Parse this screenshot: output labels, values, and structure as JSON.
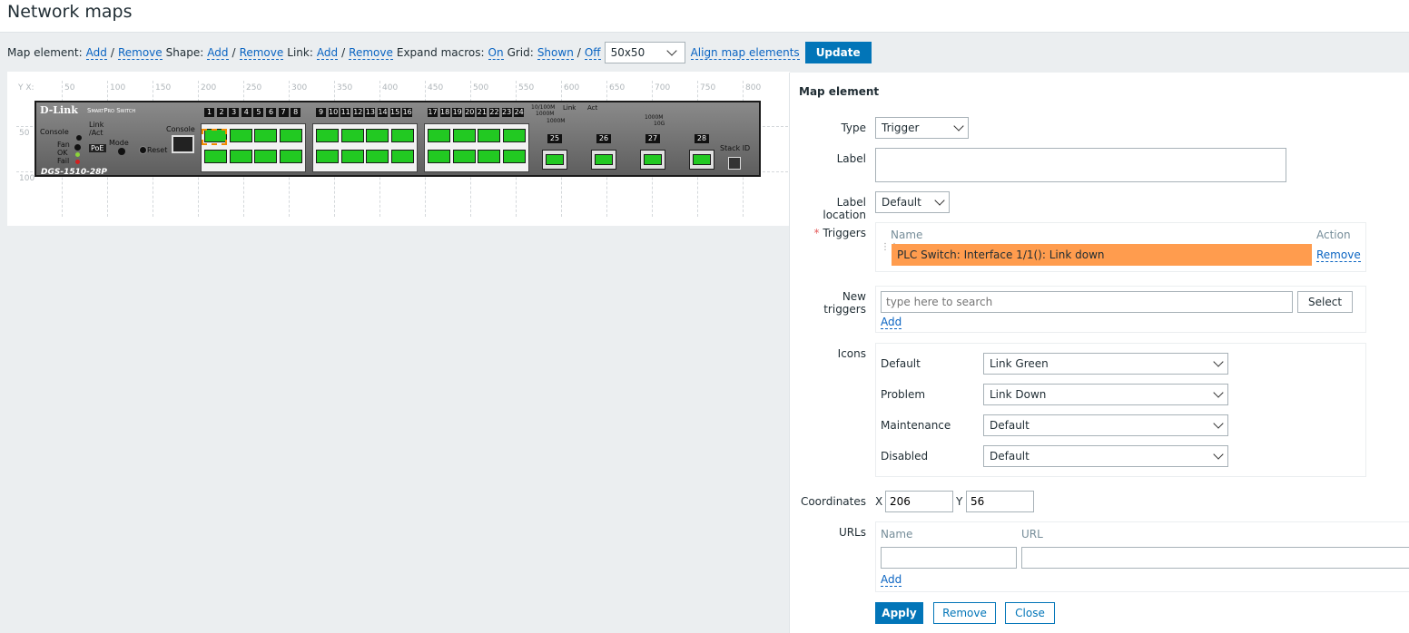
{
  "page": {
    "title": "Network maps"
  },
  "toolbar": {
    "map_element_label": "Map element:",
    "shape_label": "Shape:",
    "link_label": "Link:",
    "add": "Add",
    "remove": "Remove",
    "slash": "/",
    "expand_macros_label": "Expand macros:",
    "expand_macros_value": "On",
    "grid_label": "Grid:",
    "grid_shown": "Shown",
    "grid_off": "Off",
    "grid_size": "50x50",
    "align": "Align map elements",
    "update": "Update"
  },
  "map": {
    "x_axis_title": "Y X:",
    "x_ticks": [
      "50",
      "100",
      "150",
      "200",
      "250",
      "300",
      "350",
      "400",
      "450",
      "500",
      "550",
      "600",
      "650",
      "700",
      "750",
      "800"
    ],
    "y_ticks": [
      "50",
      "100"
    ],
    "switch": {
      "brand": "D-Link",
      "series": "SmartPro Switch",
      "model": "DGS-1510-28P",
      "console_left": "Console",
      "console_right": "Console",
      "link_act": "Link /Act",
      "poe": "PoE",
      "mode": "Mode",
      "reset": "Reset",
      "fan": "Fan",
      "ok": "OK",
      "fail": "Fail",
      "stack_id": "Stack ID",
      "legend_left_1": "10/100M",
      "legend_left_2": "1000M",
      "legend_left_3": "1000M",
      "legend_link": "Link",
      "legend_act": "Act",
      "legend_right_1": "1000M",
      "legend_right_2": "10G",
      "port_numbers": [
        "1",
        "2",
        "3",
        "4",
        "5",
        "6",
        "7",
        "8",
        "9",
        "10",
        "11",
        "12",
        "13",
        "14",
        "15",
        "16",
        "17",
        "18",
        "19",
        "20",
        "21",
        "22",
        "23",
        "24"
      ],
      "sfp_numbers": [
        "25",
        "26",
        "27",
        "28"
      ]
    }
  },
  "panel": {
    "title": "Map element",
    "type_label": "Type",
    "type_value": "Trigger",
    "label_label": "Label",
    "label_value": "",
    "label_location_label": "Label location",
    "label_location_value": "Default",
    "triggers_label": "Triggers",
    "triggers_required_mark": "*",
    "triggers_col_name": "Name",
    "triggers_col_action": "Action",
    "trigger_rows": [
      {
        "name": "PLC Switch: Interface 1/1(): Link down",
        "action": "Remove"
      }
    ],
    "new_triggers_label": "New triggers",
    "new_triggers_placeholder": "type here to search",
    "select_button": "Select",
    "add_link": "Add",
    "icons_label": "Icons",
    "icons": [
      {
        "label": "Default",
        "value": "Link Green"
      },
      {
        "label": "Problem",
        "value": "Link Down"
      },
      {
        "label": "Maintenance",
        "value": "Default"
      },
      {
        "label": "Disabled",
        "value": "Default"
      }
    ],
    "coordinates_label": "Coordinates",
    "x_label": "X",
    "x_value": "206",
    "y_label": "Y",
    "y_value": "56",
    "urls_label": "URLs",
    "urls_col_name": "Name",
    "urls_col_url": "URL",
    "urls_add": "Add",
    "apply": "Apply",
    "remove": "Remove",
    "close": "Close"
  }
}
